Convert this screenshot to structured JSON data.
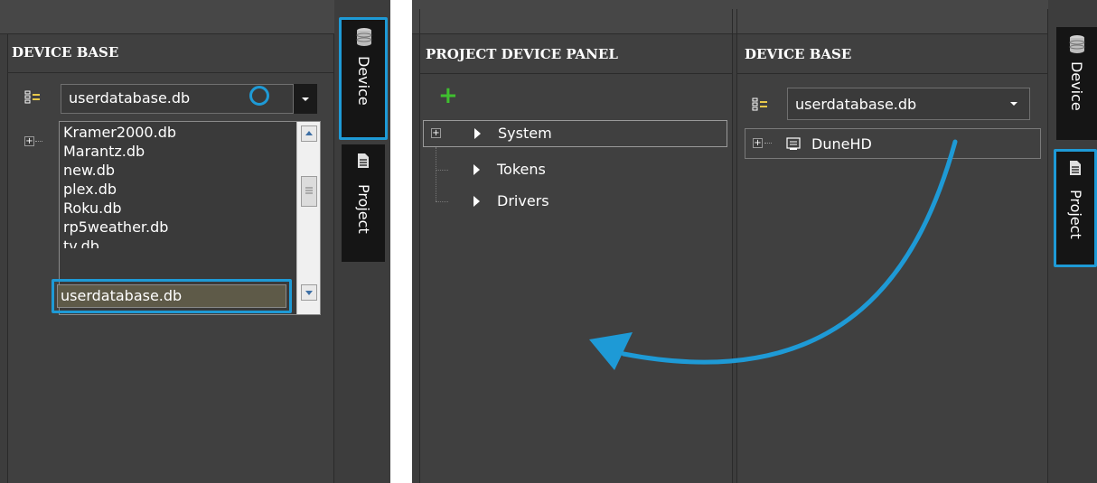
{
  "left_panel": {
    "title": "DEVICE BASE",
    "combo_value": "userdatabase.db",
    "dropdown_items": [
      "Kramer2000.db",
      "Marantz.db",
      "new.db",
      "plex.db",
      "Roku.db",
      "rp5weather.db",
      "tv.db"
    ],
    "selected_item": "userdatabase.db"
  },
  "left_sidebar": {
    "device_tab": "Device",
    "project_tab": "Project"
  },
  "project_panel": {
    "title": "PROJECT DEVICE PANEL",
    "add_glyph": "+",
    "tree": [
      "System",
      "Tokens",
      "Drivers"
    ]
  },
  "right_panel": {
    "title": "DEVICE BASE",
    "combo_value": "userdatabase.db",
    "tree_device": "DuneHD"
  },
  "right_sidebar": {
    "device_tab": "Device",
    "project_tab": "Project"
  },
  "icons": {
    "list": "list-icon",
    "database": "database-icon",
    "document": "document-icon",
    "device": "device-icon"
  },
  "colors": {
    "highlight": "#1e9ad6",
    "panel_bg": "#404040",
    "add_green": "#3fbf2f"
  }
}
